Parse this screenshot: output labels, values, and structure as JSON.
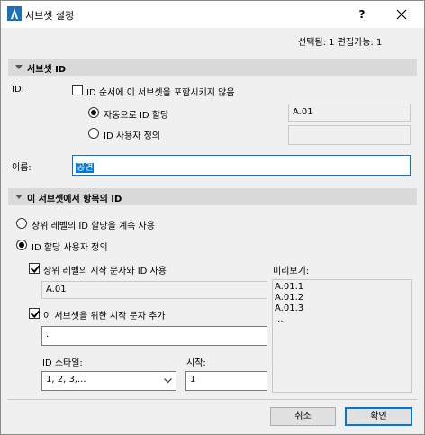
{
  "window": {
    "title": "서브셋 설정",
    "help_label": "?"
  },
  "status": "선택됨: 1 편집가능: 1",
  "subset_section": {
    "header": "서브셋 ID",
    "id_label": "ID:",
    "exclude_checkbox_label": "ID 순서에 이 서브셋을 포함시키지 않음",
    "exclude_checked": false,
    "auto_radio_label": "자동으로 ID 할당",
    "auto_selected": true,
    "auto_value": "A.01",
    "custom_radio_label": "ID 사용자 정의",
    "custom_selected": false,
    "custom_value": "",
    "name_label": "이름:",
    "name_value": "공연"
  },
  "item_section": {
    "header": "이 서브셋에서 항목의 ID",
    "continue_radio_label": "상위 레벨의 ID 할당을 계속 사용",
    "continue_selected": false,
    "custom_radio_label": "ID 할당 사용자 정의",
    "custom_selected": true,
    "use_parent_checkbox_label": "상위 레벨의 시작 문자와 ID 사용",
    "use_parent_checked": true,
    "parent_value": "A.01",
    "add_prefix_checkbox_label": "이 서브셋을 위한 시작 문자 추가",
    "add_prefix_checked": true,
    "prefix_value": ".",
    "id_style_label": "ID 스타일:",
    "id_style_value": "1, 2, 3,...",
    "start_label": "시작:",
    "start_value": "1",
    "preview_label": "미리보기:",
    "preview_items": [
      "A.01.1",
      "A.01.2",
      "A.01.3",
      "..."
    ]
  },
  "buttons": {
    "cancel": "취소",
    "ok": "확인"
  }
}
